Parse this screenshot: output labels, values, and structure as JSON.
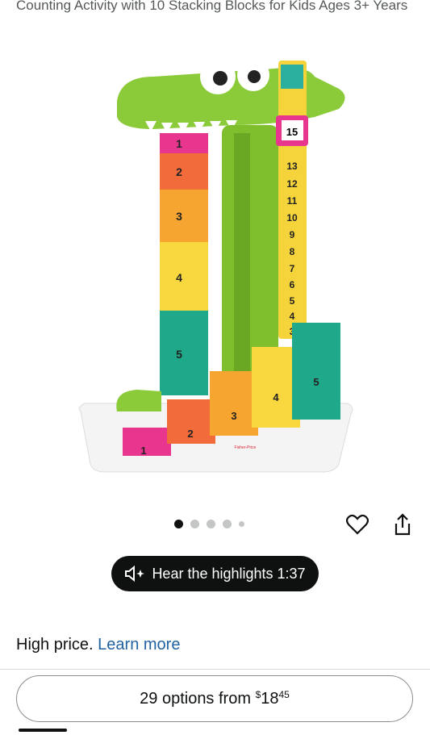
{
  "product": {
    "title": "Counting Activity with 10 Stacking Blocks for Kids Ages 3+ Years",
    "image_icon": "crocodile-counting-toy-image",
    "gauge_numbers": [
      "15",
      "13",
      "12",
      "11",
      "10",
      "9",
      "8",
      "7",
      "6",
      "5",
      "4",
      "3"
    ],
    "stack_numbers": [
      "1",
      "2",
      "3",
      "4",
      "5"
    ],
    "base_blocks": [
      "1",
      "2",
      "3",
      "4",
      "5"
    ],
    "brand_mark": "Fisher-Price"
  },
  "carousel": {
    "count": 5,
    "active_index": 0
  },
  "actions": {
    "favorite_icon": "heart-icon",
    "share_icon": "share-icon"
  },
  "audio": {
    "label": "Hear the highlights 1:37",
    "icon": "speaker-sparkle-icon"
  },
  "price_note": {
    "text": "High price.",
    "link": "Learn more"
  },
  "options": {
    "prefix": "29 options from ",
    "currency": "$",
    "dollars": "18",
    "cents": "45"
  },
  "colors": {
    "link": "#2162a1",
    "pill_bg": "#0f1111",
    "croc_green": "#8bcb3a",
    "teal": "#1fa889"
  }
}
